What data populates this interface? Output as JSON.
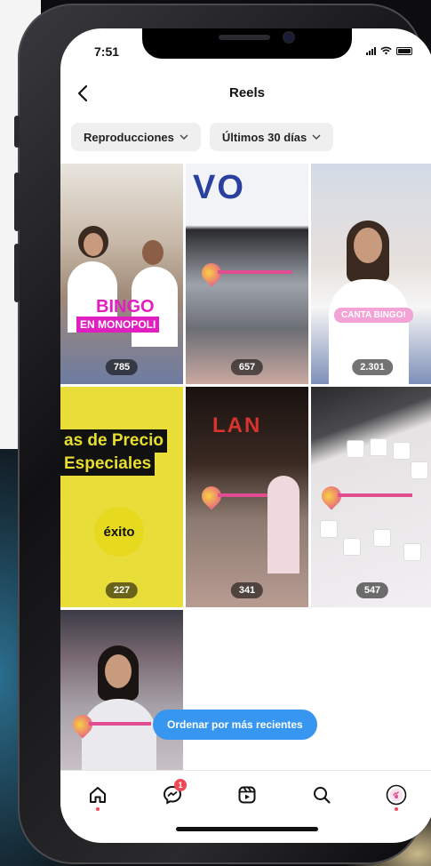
{
  "status_bar": {
    "time": "7:51"
  },
  "header": {
    "title": "Reels"
  },
  "filters": [
    {
      "label": "Reproducciones"
    },
    {
      "label": "Últimos 30 días"
    }
  ],
  "reels": [
    {
      "views": "785",
      "overlay": "BINGO",
      "overlay_sub": "EN MONOPOLI"
    },
    {
      "views": "657",
      "store_sign": "VO"
    },
    {
      "views": "2.301",
      "overlay": "CANTA BINGO!"
    },
    {
      "views": "227",
      "line1": "as de Precio",
      "line2": "Especiales",
      "logo": "éxito"
    },
    {
      "views": "341",
      "store_sign": "LAN"
    },
    {
      "views": "547"
    },
    {
      "views": ""
    }
  ],
  "sort_button": {
    "label": "Ordenar por más recientes"
  },
  "nav": {
    "items": [
      "home-icon",
      "messenger-icon",
      "reels-icon",
      "search-icon",
      "profile-icon"
    ],
    "messenger_badge": "1"
  },
  "colors": {
    "accent": "#3797f0",
    "notification": "#ed4956",
    "magenta": "#e11fc1",
    "exito_yellow": "#e6d91e"
  }
}
